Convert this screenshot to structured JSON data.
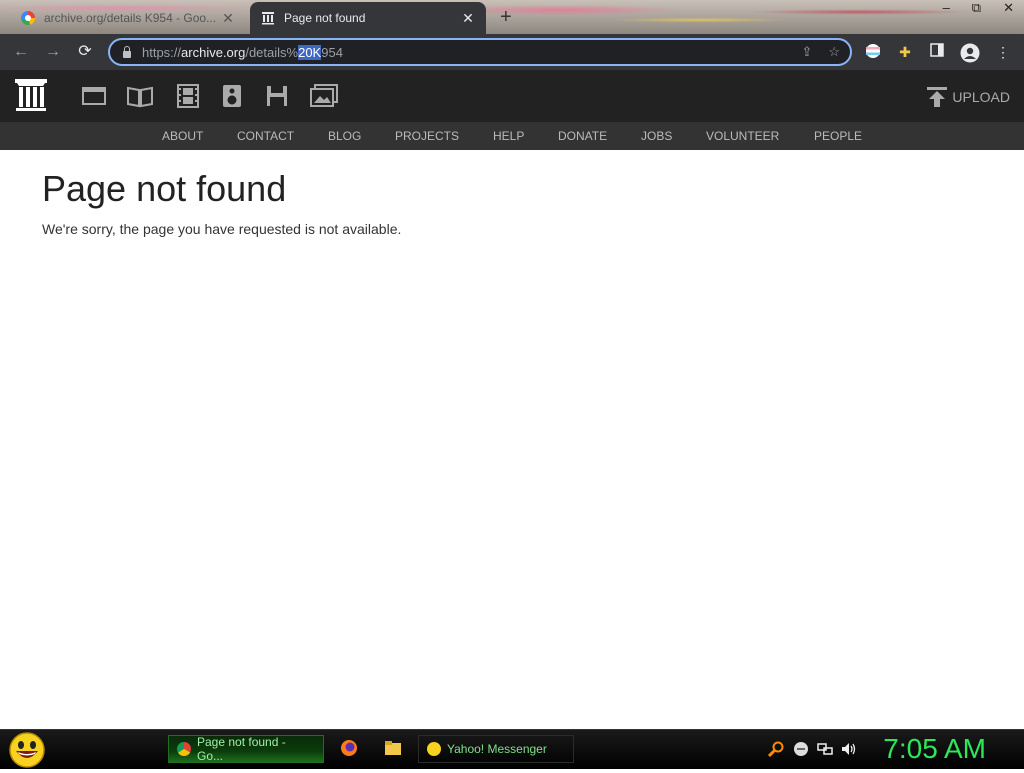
{
  "browser": {
    "tabs": [
      {
        "title": "archive.org/details K954 - Goo...",
        "icon": "google-favicon",
        "active": false
      },
      {
        "title": "Page not found",
        "icon": "archive-favicon",
        "active": true
      }
    ],
    "new_tab_label": "+",
    "window_controls": {
      "minimize": "–",
      "maximize": "⧉",
      "close": "✕"
    },
    "url": {
      "scheme": "https://",
      "host": "archive.org",
      "path_before": "/details%",
      "selected": "20K",
      "path_after": "954"
    }
  },
  "archive": {
    "media_icons": [
      "web-icon",
      "texts-icon",
      "video-icon",
      "audio-icon",
      "software-icon",
      "images-icon"
    ],
    "upload_label": "UPLOAD",
    "nav": [
      "ABOUT",
      "CONTACT",
      "BLOG",
      "PROJECTS",
      "HELP",
      "DONATE",
      "JOBS",
      "VOLUNTEER",
      "PEOPLE"
    ]
  },
  "content": {
    "title": "Page not found",
    "message": "We're sorry, the page you have requested is not available."
  },
  "taskbar": {
    "tasks": [
      {
        "label": "Page not found - Go...",
        "icon": "chrome-icon"
      },
      {
        "label": "Yahoo! Messenger",
        "icon": "yahoo-messenger-icon"
      }
    ],
    "clock": "7:05 AM"
  },
  "colors": {
    "accent_blue": "#8ab4f8",
    "clock_green": "#2ee65b",
    "archive_header": "#222222"
  }
}
